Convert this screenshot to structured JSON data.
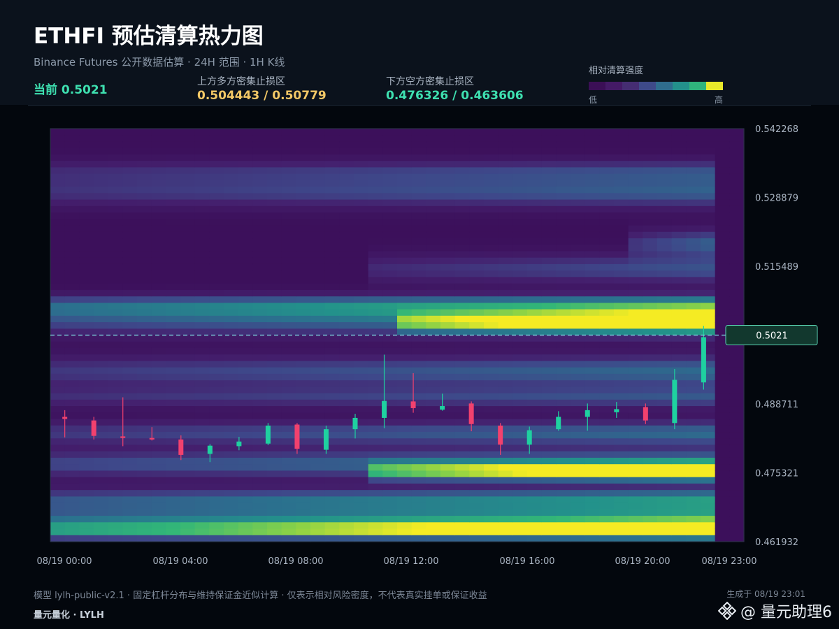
{
  "header": {
    "title": "ETHFI 预估清算热力图",
    "subtitle": "Binance Futures 公开数据估算 · 24H 范围 · 1H K线",
    "current": "当前 0.5021",
    "upper_label": "上方多方密集止损区",
    "upper_value": "0.504443 / 0.50779",
    "lower_label": "下方空方密集止损区",
    "lower_value": "0.476326 / 0.463606"
  },
  "legend": {
    "title": "相对清算强度",
    "low": "低",
    "high": "高",
    "colors": [
      "#3b0f56",
      "#441a66",
      "#452d72",
      "#3e4a89",
      "#2f6d8e",
      "#23908b",
      "#2fb47c",
      "#e8e82a"
    ]
  },
  "footer": {
    "note": "模型 lylh-public-v2.1 · 固定杠杆分布与维持保证金近似计算 · 仅表示相对风险密度，不代表真实挂单或保证收益",
    "generated": "生成于 08/19 23:01",
    "brand": "量元量化 · LYLH",
    "watermark": "@ 量元助理6"
  },
  "chart_data": {
    "type": "heatmap",
    "x_tick_labels": [
      "08/19 00:00",
      "08/19 04:00",
      "08/19 08:00",
      "08/19 12:00",
      "08/19 16:00",
      "08/19 20:00",
      "08/19 23:00"
    ],
    "y_tick_labels": [
      "0.542268",
      "0.528879",
      "0.515489",
      "0.502100",
      "0.488711",
      "0.475321",
      "0.461932"
    ],
    "ylim": [
      0.461932,
      0.542268
    ],
    "current_price": 0.5021,
    "current_price_label": "0.5021",
    "candles": [
      {
        "t": 0,
        "o": 0.4862,
        "h": 0.4875,
        "l": 0.4822,
        "c": 0.4858
      },
      {
        "t": 1,
        "o": 0.4855,
        "h": 0.4862,
        "l": 0.4818,
        "c": 0.4825
      },
      {
        "t": 2,
        "o": 0.4824,
        "h": 0.49,
        "l": 0.4805,
        "c": 0.4821
      },
      {
        "t": 3,
        "o": 0.4821,
        "h": 0.4842,
        "l": 0.4816,
        "c": 0.4818
      },
      {
        "t": 4,
        "o": 0.4818,
        "h": 0.4826,
        "l": 0.4778,
        "c": 0.4788
      },
      {
        "t": 5,
        "o": 0.479,
        "h": 0.4809,
        "l": 0.4774,
        "c": 0.4806
      },
      {
        "t": 6,
        "o": 0.4805,
        "h": 0.4823,
        "l": 0.4797,
        "c": 0.4814
      },
      {
        "t": 7,
        "o": 0.481,
        "h": 0.485,
        "l": 0.4807,
        "c": 0.4845
      },
      {
        "t": 8,
        "o": 0.4847,
        "h": 0.485,
        "l": 0.479,
        "c": 0.48
      },
      {
        "t": 9,
        "o": 0.4798,
        "h": 0.4845,
        "l": 0.479,
        "c": 0.4838
      },
      {
        "t": 10,
        "o": 0.4838,
        "h": 0.4868,
        "l": 0.482,
        "c": 0.486
      },
      {
        "t": 11,
        "o": 0.486,
        "h": 0.4983,
        "l": 0.484,
        "c": 0.4893
      },
      {
        "t": 12,
        "o": 0.4892,
        "h": 0.4947,
        "l": 0.487,
        "c": 0.4879
      },
      {
        "t": 13,
        "o": 0.4876,
        "h": 0.4907,
        "l": 0.4874,
        "c": 0.4883
      },
      {
        "t": 14,
        "o": 0.4888,
        "h": 0.4892,
        "l": 0.4834,
        "c": 0.4848
      },
      {
        "t": 15,
        "o": 0.4845,
        "h": 0.485,
        "l": 0.4788,
        "c": 0.4808
      },
      {
        "t": 16,
        "o": 0.4808,
        "h": 0.4843,
        "l": 0.479,
        "c": 0.4836
      },
      {
        "t": 17,
        "o": 0.4838,
        "h": 0.4873,
        "l": 0.4835,
        "c": 0.4862
      },
      {
        "t": 18,
        "o": 0.4862,
        "h": 0.4888,
        "l": 0.4835,
        "c": 0.4875
      },
      {
        "t": 19,
        "o": 0.4871,
        "h": 0.4891,
        "l": 0.486,
        "c": 0.4877
      },
      {
        "t": 20,
        "o": 0.4881,
        "h": 0.4888,
        "l": 0.4848,
        "c": 0.4855
      },
      {
        "t": 21,
        "o": 0.485,
        "h": 0.4955,
        "l": 0.4838,
        "c": 0.4934
      },
      {
        "t": 22,
        "o": 0.4929,
        "h": 0.5039,
        "l": 0.4915,
        "c": 0.5017
      }
    ],
    "bands": [
      {
        "price": 0.464,
        "width": 0.0016,
        "strength": 0.88,
        "t0": 0,
        "t1": 23
      },
      {
        "price": 0.466,
        "width": 0.0025,
        "strength": 0.72,
        "t0": 0,
        "t1": 23
      },
      {
        "price": 0.47,
        "width": 0.0022,
        "strength": 0.62,
        "t0": 0,
        "t1": 23
      },
      {
        "price": 0.4755,
        "width": 0.0016,
        "strength": 0.95,
        "t0": 11,
        "t1": 23
      },
      {
        "price": 0.477,
        "width": 0.0026,
        "strength": 0.55,
        "t0": 0,
        "t1": 23
      },
      {
        "price": 0.483,
        "width": 0.0024,
        "strength": 0.45,
        "t0": 0,
        "t1": 23
      },
      {
        "price": 0.49,
        "width": 0.002,
        "strength": 0.35,
        "t0": 0,
        "t1": 23
      },
      {
        "price": 0.495,
        "width": 0.003,
        "strength": 0.45,
        "t0": 0,
        "t1": 23
      },
      {
        "price": 0.5044,
        "width": 0.0018,
        "strength": 0.8,
        "t0": 12,
        "t1": 23
      },
      {
        "price": 0.505,
        "width": 0.003,
        "strength": 0.55,
        "t0": 0,
        "t1": 23
      },
      {
        "price": 0.5078,
        "width": 0.002,
        "strength": 0.6,
        "t0": 0,
        "t1": 23
      },
      {
        "price": 0.515,
        "width": 0.0028,
        "strength": 0.35,
        "t0": 11,
        "t1": 23
      },
      {
        "price": 0.52,
        "width": 0.0025,
        "strength": 0.4,
        "t0": 20,
        "t1": 23
      },
      {
        "price": 0.53,
        "width": 0.003,
        "strength": 0.4,
        "t0": 0,
        "t1": 23
      },
      {
        "price": 0.534,
        "width": 0.0022,
        "strength": 0.3,
        "t0": 0,
        "t1": 23
      }
    ]
  }
}
